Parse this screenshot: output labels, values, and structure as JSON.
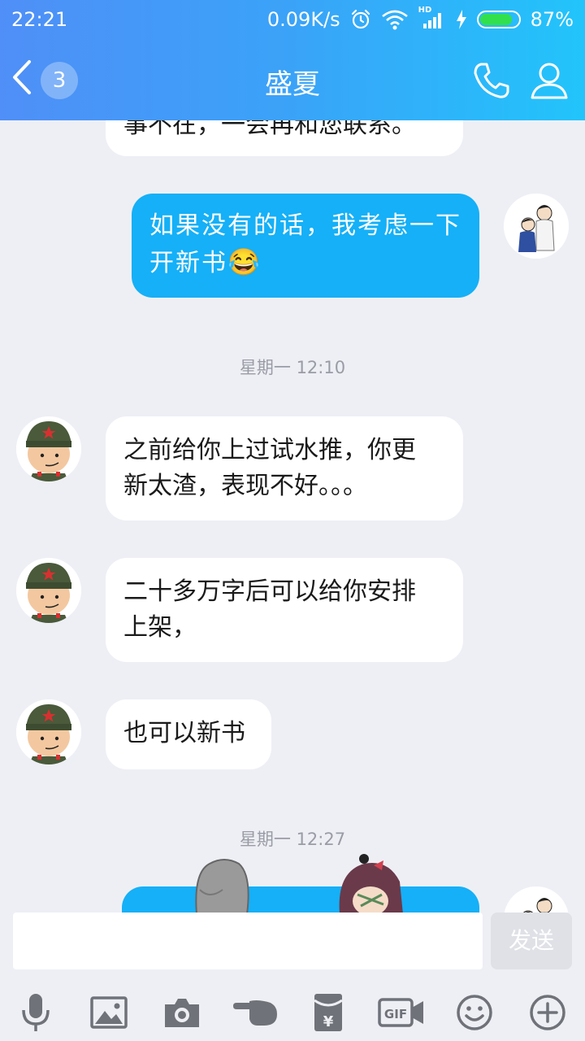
{
  "status_bar": {
    "time": "22:21",
    "network_speed": "0.09K/s",
    "signal_label": "HD",
    "battery_percent": "87%",
    "battery_level": 0.87
  },
  "header": {
    "unread_count": "3",
    "title": "盛夏"
  },
  "messages": [
    {
      "text": "事不在，一会再和您联系。"
    },
    {
      "line1": "如果没有的话，我考虑一下",
      "line2": "开新书",
      "emoji": "😂"
    },
    {
      "line1": "之前给你上过试水推，你更",
      "line2": "新太渣，表现不好。。。"
    },
    {
      "line1": "二十多万字后可以给你安排",
      "line2": "上架，"
    },
    {
      "text": "也可以新书"
    }
  ],
  "timestamps": [
    "星期一 12:10",
    "星期一 12:27"
  ],
  "input": {
    "value": "",
    "send_label": "发送"
  },
  "toolbar": {
    "icons": [
      "microphone-icon",
      "image-icon",
      "camera-icon",
      "poke-icon",
      "red-packet-icon",
      "gif-icon",
      "emoji-icon",
      "plus-icon"
    ],
    "gif_label": "GIF",
    "money_symbol": "¥"
  },
  "colors": {
    "header_gradient_start": "#4f8ff7",
    "header_gradient_end": "#22c4fb",
    "my_bubble": "#15b0f7",
    "their_bubble": "#ffffff",
    "background": "#eeeff5"
  }
}
